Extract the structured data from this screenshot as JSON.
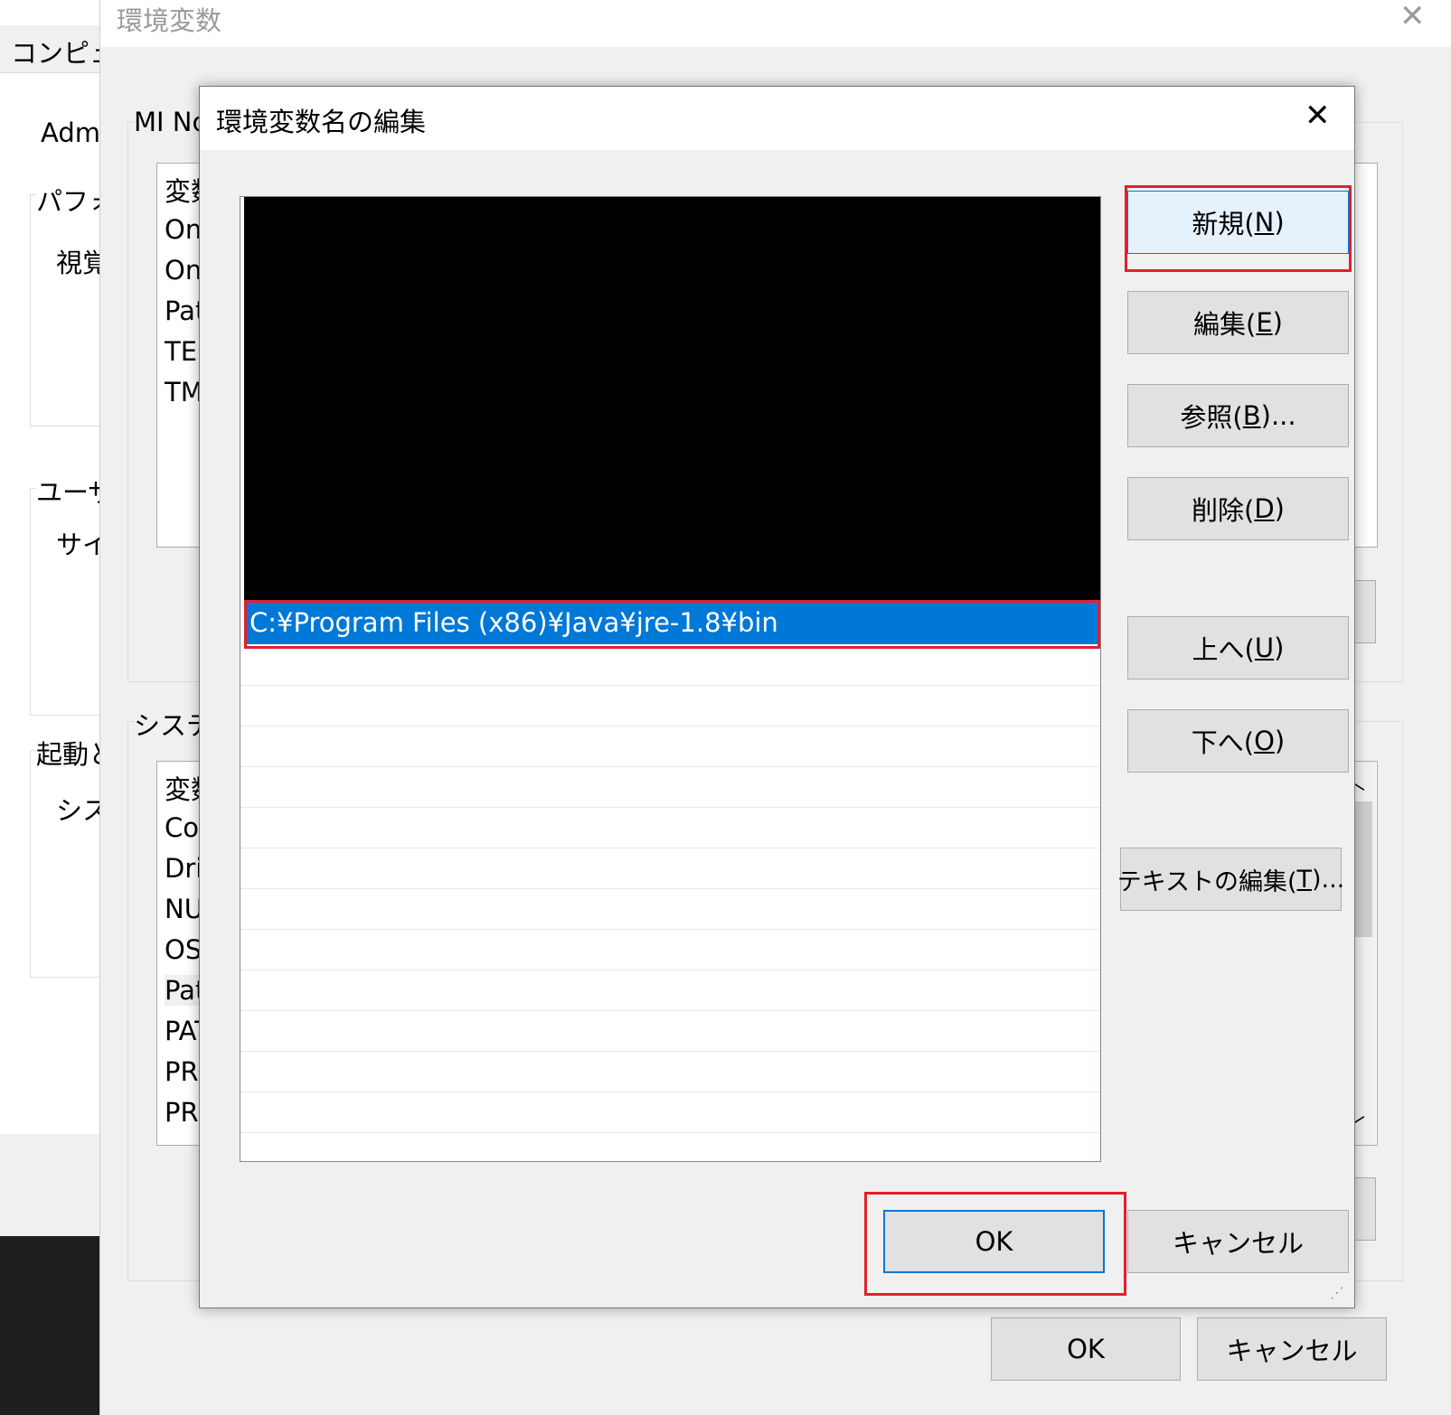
{
  "background_window": {
    "tab_label": "コンピュー",
    "admin_label": "Adm",
    "perf_group": "パフォ",
    "perf_text": "視覚",
    "user_profile_group": "ユーザ",
    "user_profile_text": "サイ",
    "startup_group": "起動と",
    "startup_text": "シス"
  },
  "env_dialog": {
    "title": "環境変数",
    "close_glyph": "✕",
    "user_vars_group": "MI Nc",
    "user_vars_header": "変数",
    "user_vars": [
      "One",
      "One",
      "Pat",
      "TEN",
      "TM"
    ],
    "system_vars_group": "システ",
    "system_vars_header": "変数",
    "system_vars": [
      "Cor",
      "Driv",
      "NU",
      "OS",
      "Pat",
      "PAT",
      "PRC",
      "PRC"
    ],
    "ok_label": "OK",
    "cancel_label": "キャンセル",
    "scroll_up_glyph": "︿",
    "scroll_down_glyph": "﹀"
  },
  "edit_dialog": {
    "title": "環境変数名の編集",
    "close_glyph": "✕",
    "selected_path": "C:¥Program Files (x86)¥Java¥jre-1.8¥bin",
    "cutoff_text": "...g... (...)",
    "buttons": {
      "new": {
        "text": "新規(",
        "key": "N",
        "tail": ")"
      },
      "edit": {
        "text": "編集(",
        "key": "E",
        "tail": ")"
      },
      "browse": {
        "text": "参照(",
        "key": "B",
        "tail": ")..."
      },
      "delete": {
        "text": "削除(",
        "key": "D",
        "tail": ")"
      },
      "up": {
        "text": "上へ(",
        "key": "U",
        "tail": ")"
      },
      "down": {
        "text": "下へ(",
        "key": "O",
        "tail": ")"
      },
      "edit_text": {
        "text": "テキストの編集(",
        "key": "T",
        "tail": ")..."
      }
    },
    "ok_label": "OK",
    "cancel_label": "キャンセル",
    "highlight_color": "#e0202c",
    "selection_color": "#0078d7"
  }
}
